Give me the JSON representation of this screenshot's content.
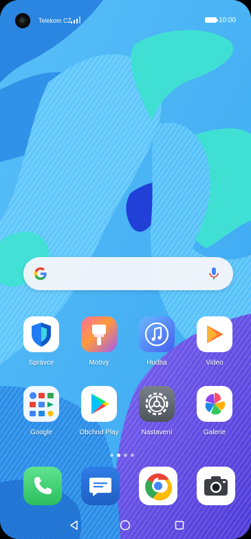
{
  "status_bar": {
    "carrier": "Telekom CZ",
    "clock": "10:00"
  },
  "search": {
    "logo_icon": "google-g-icon",
    "voice_icon": "mic-icon"
  },
  "apps": [
    {
      "label": "Správce",
      "icon": "shield-icon"
    },
    {
      "label": "Motivy",
      "icon": "paint-brush-icon"
    },
    {
      "label": "Hudba",
      "icon": "music-note-icon"
    },
    {
      "label": "Video",
      "icon": "play-icon"
    },
    {
      "label": "Google",
      "icon": "google-folder-icon"
    },
    {
      "label": "Obchod Play",
      "icon": "play-store-icon"
    },
    {
      "label": "Nastavení",
      "icon": "gear-icon"
    },
    {
      "label": "Galerie",
      "icon": "pinwheel-icon"
    }
  ],
  "dock": [
    {
      "icon": "phone-icon"
    },
    {
      "icon": "messages-icon"
    },
    {
      "icon": "chrome-icon"
    },
    {
      "icon": "camera-icon"
    }
  ],
  "nav": {
    "back_icon": "back-triangle-icon",
    "home_icon": "home-circle-icon",
    "recents_icon": "recents-square-icon"
  },
  "colors": {
    "wallpaper_base": "#49b3f5",
    "wallpaper_dark": "#1f78d8",
    "wallpaper_teal": "#3fe0d3",
    "wallpaper_purple": "#6a52e6"
  }
}
